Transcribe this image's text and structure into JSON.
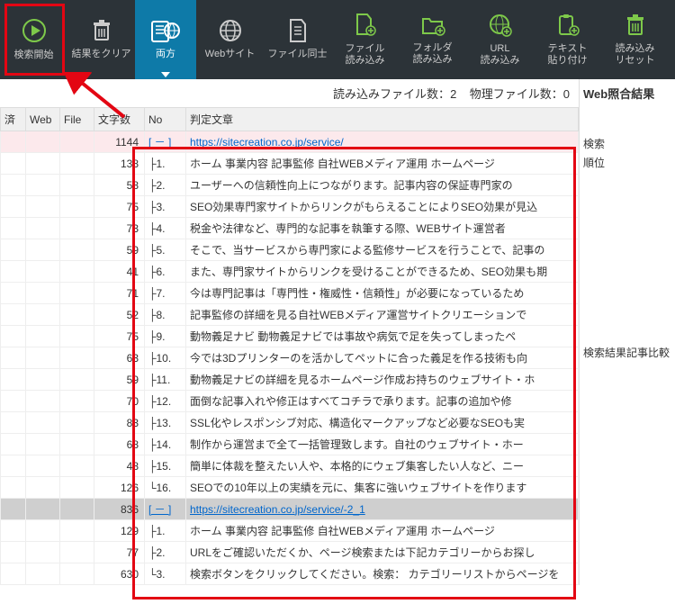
{
  "toolbar": {
    "items": [
      {
        "label": "検索開始"
      },
      {
        "label": "結果をクリア"
      },
      {
        "label": "両方"
      },
      {
        "label": "Webサイト"
      },
      {
        "label": "ファイル同士"
      },
      {
        "label": "ファイル\n読み込み"
      },
      {
        "label": "フォルダ\n読み込み"
      },
      {
        "label": "URL\n読み込み"
      },
      {
        "label": "テキスト\n貼り付け"
      },
      {
        "label": "読み込み\nリセット"
      }
    ]
  },
  "status": {
    "load_label": "読み込みファイル数：",
    "load_count": "2",
    "phys_label": "物理ファイル数：",
    "phys_count": "0"
  },
  "headers": {
    "sumi": "済",
    "web": "Web",
    "file": "File",
    "chars": "文字数",
    "no": "No",
    "text": "判定文章"
  },
  "rows": [
    {
      "chars": "1144",
      "no": "[ － ]",
      "text": "https://sitecreation.co.jp/service/",
      "link": true,
      "cls": "pink"
    },
    {
      "chars": "138",
      "no": "├1.",
      "text": "ホーム 事業内容 記事監修 自社WEBメディア運用 ホームページ"
    },
    {
      "chars": "58",
      "no": "├2.",
      "text": "ユーザーへの信頼性向上につながります。記事内容の保証専門家の"
    },
    {
      "chars": "75",
      "no": "├3.",
      "text": "SEO効果専門家サイトからリンクがもらえることによりSEO効果が見込"
    },
    {
      "chars": "73",
      "no": "├4.",
      "text": "税金や法律など、専門的な記事を執筆する際、WEBサイト運営者"
    },
    {
      "chars": "59",
      "no": "├5.",
      "text": "そこで、当サービスから専門家による監修サービスを行うことで、記事の"
    },
    {
      "chars": "41",
      "no": "├6.",
      "text": "また、専門家サイトからリンクを受けることができるため、SEO効果も期"
    },
    {
      "chars": "71",
      "no": "├7.",
      "text": "今は専門記事は「専門性・権威性・信頼性」が必要になっているため"
    },
    {
      "chars": "52",
      "no": "├8.",
      "text": "記事監修の詳細を見る自社WEBメディア運営サイトクリエーションで"
    },
    {
      "chars": "75",
      "no": "├9.",
      "text": "動物義足ナビ 動物義足ナビでは事故や病気で足を失ってしまったペ"
    },
    {
      "chars": "63",
      "no": "├10.",
      "text": "今では3Dプリンターのを活かしてペットに合った義足を作る技術も向"
    },
    {
      "chars": "59",
      "no": "├11.",
      "text": "動物義足ナビの詳細を見るホームページ作成お持ちのウェブサイト・ホ"
    },
    {
      "chars": "70",
      "no": "├12.",
      "text": "面倒な記事入れや修正はすべてコチラで承ります。記事の追加や修"
    },
    {
      "chars": "83",
      "no": "├13.",
      "text": "SSL化やレスポンシブ対応、構造化マークアップなど必要なSEOも実"
    },
    {
      "chars": "68",
      "no": "├14.",
      "text": "制作から運営まで全て一括管理致します。自社のウェブサイト・ホー"
    },
    {
      "chars": "48",
      "no": "├15.",
      "text": "簡単に体裁を整えたい人や、本格的にウェブ集客したい人など、ニー"
    },
    {
      "chars": "126",
      "no": "└16.",
      "text": "SEOでの10年以上の実績を元に、集客に強いウェブサイトを作ります"
    },
    {
      "chars": "836",
      "no": "[ － ]",
      "text": "https://sitecreation.co.jp/service/-2_1",
      "link": true,
      "cls": "sel"
    },
    {
      "chars": "129",
      "no": "├1.",
      "text": "ホーム 事業内容 記事監修 自社WEBメディア運用 ホームページ"
    },
    {
      "chars": "77",
      "no": "├2.",
      "text": "URLをご確認いただくか、ページ検索または下記カテゴリーからお探し"
    },
    {
      "chars": "630",
      "no": "└3.",
      "text": "検索ボタンをクリックしてください。検索： カテゴリーリストからページを"
    }
  ],
  "side": {
    "title": "Web照合結果",
    "l1": "検索",
    "l2": "順位",
    "l3": "検索結果記事比較"
  }
}
